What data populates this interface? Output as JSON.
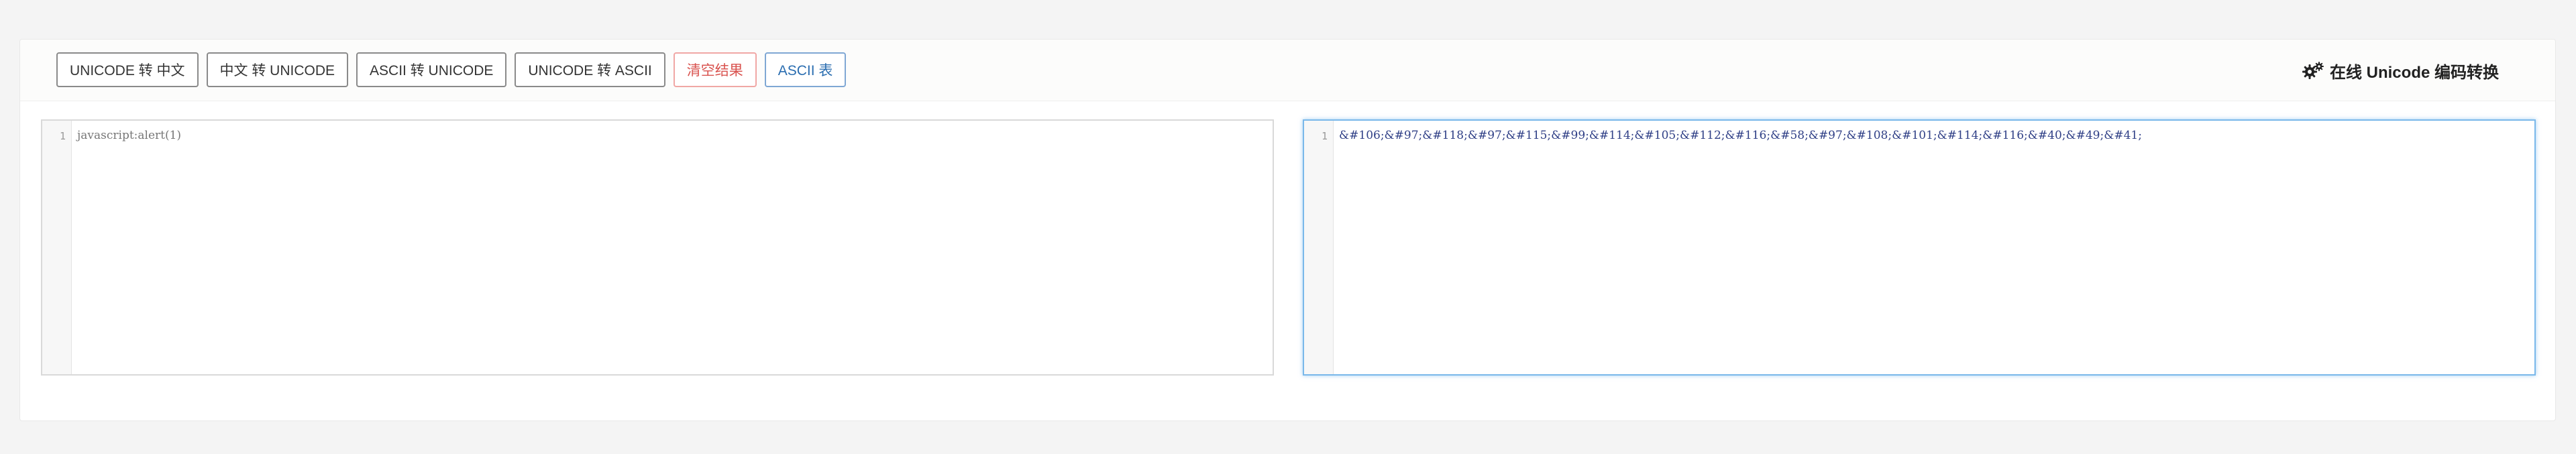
{
  "toolbar": {
    "buttons": [
      {
        "label": "UNICODE 转 中文"
      },
      {
        "label": "中文 转 UNICODE"
      },
      {
        "label": "ASCII 转 UNICODE"
      },
      {
        "label": "UNICODE 转 ASCII"
      },
      {
        "label": "清空结果"
      },
      {
        "label": "ASCII 表"
      }
    ]
  },
  "header": {
    "title": "在线 Unicode 编码转换",
    "icon": "gears-icon"
  },
  "editors": {
    "input": {
      "line_number": "1",
      "content": "javascript:alert(1)"
    },
    "output": {
      "line_number": "1",
      "content": "&#106;&#97;&#118;&#97;&#115;&#99;&#114;&#105;&#112;&#116;&#58;&#97;&#108;&#101;&#114;&#116;&#40;&#49;&#41;"
    }
  },
  "colors": {
    "danger": "#d9534f",
    "info": "#2a6db0",
    "focus_border": "#7ab8ea",
    "code_text": "#2f3f86"
  }
}
